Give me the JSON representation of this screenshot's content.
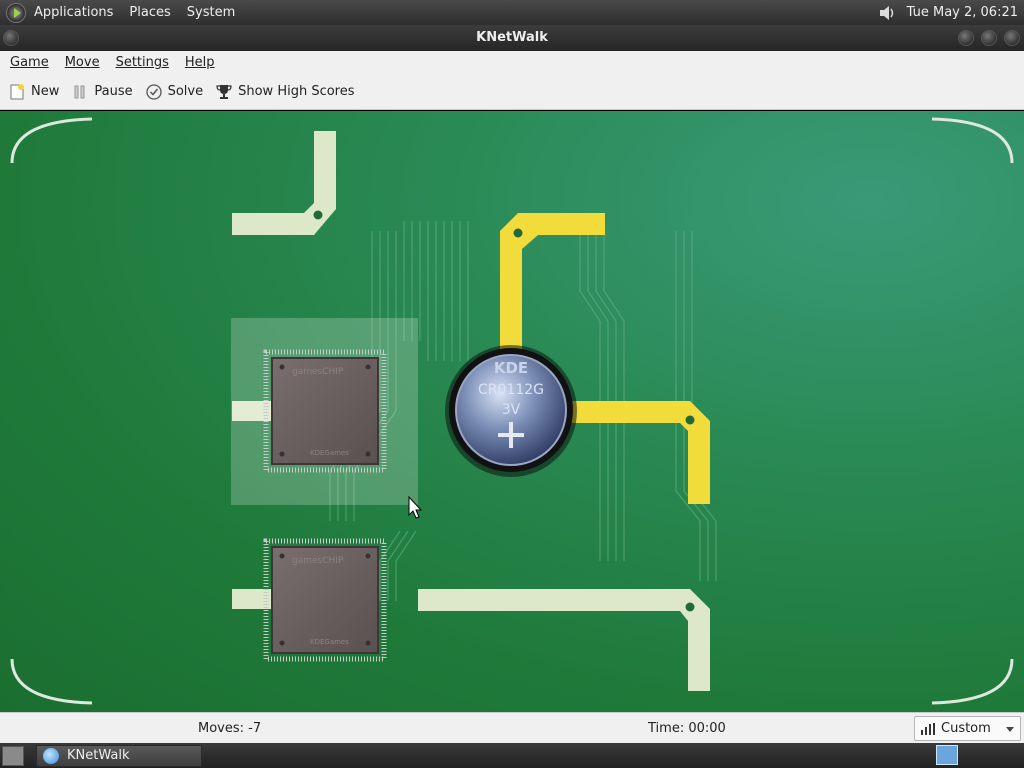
{
  "top_panel": {
    "menus": [
      "Applications",
      "Places",
      "System"
    ],
    "clock": "Tue May  2, 06:21"
  },
  "window": {
    "title": "KNetWalk"
  },
  "menubar": {
    "items": [
      "Game",
      "Move",
      "Settings",
      "Help"
    ]
  },
  "toolbar": {
    "new_label": "New",
    "pause_label": "Pause",
    "solve_label": "Solve",
    "highscores_label": "Show High Scores"
  },
  "board": {
    "server_label_1": "KDE",
    "server_label_2": "CR0112G",
    "server_label_3": "3V",
    "chip_label_1": "gamesCHIP",
    "chip_label_2": "KDEGames"
  },
  "status": {
    "moves": "Moves: -7",
    "time": "Time: 00:00",
    "difficulty": "Custom"
  },
  "taskbar": {
    "task_label": "KNetWalk"
  },
  "colors": {
    "board": "#1f7a3a",
    "cable_off": "#dde8c8",
    "cable_on": "#f2dc3c"
  }
}
